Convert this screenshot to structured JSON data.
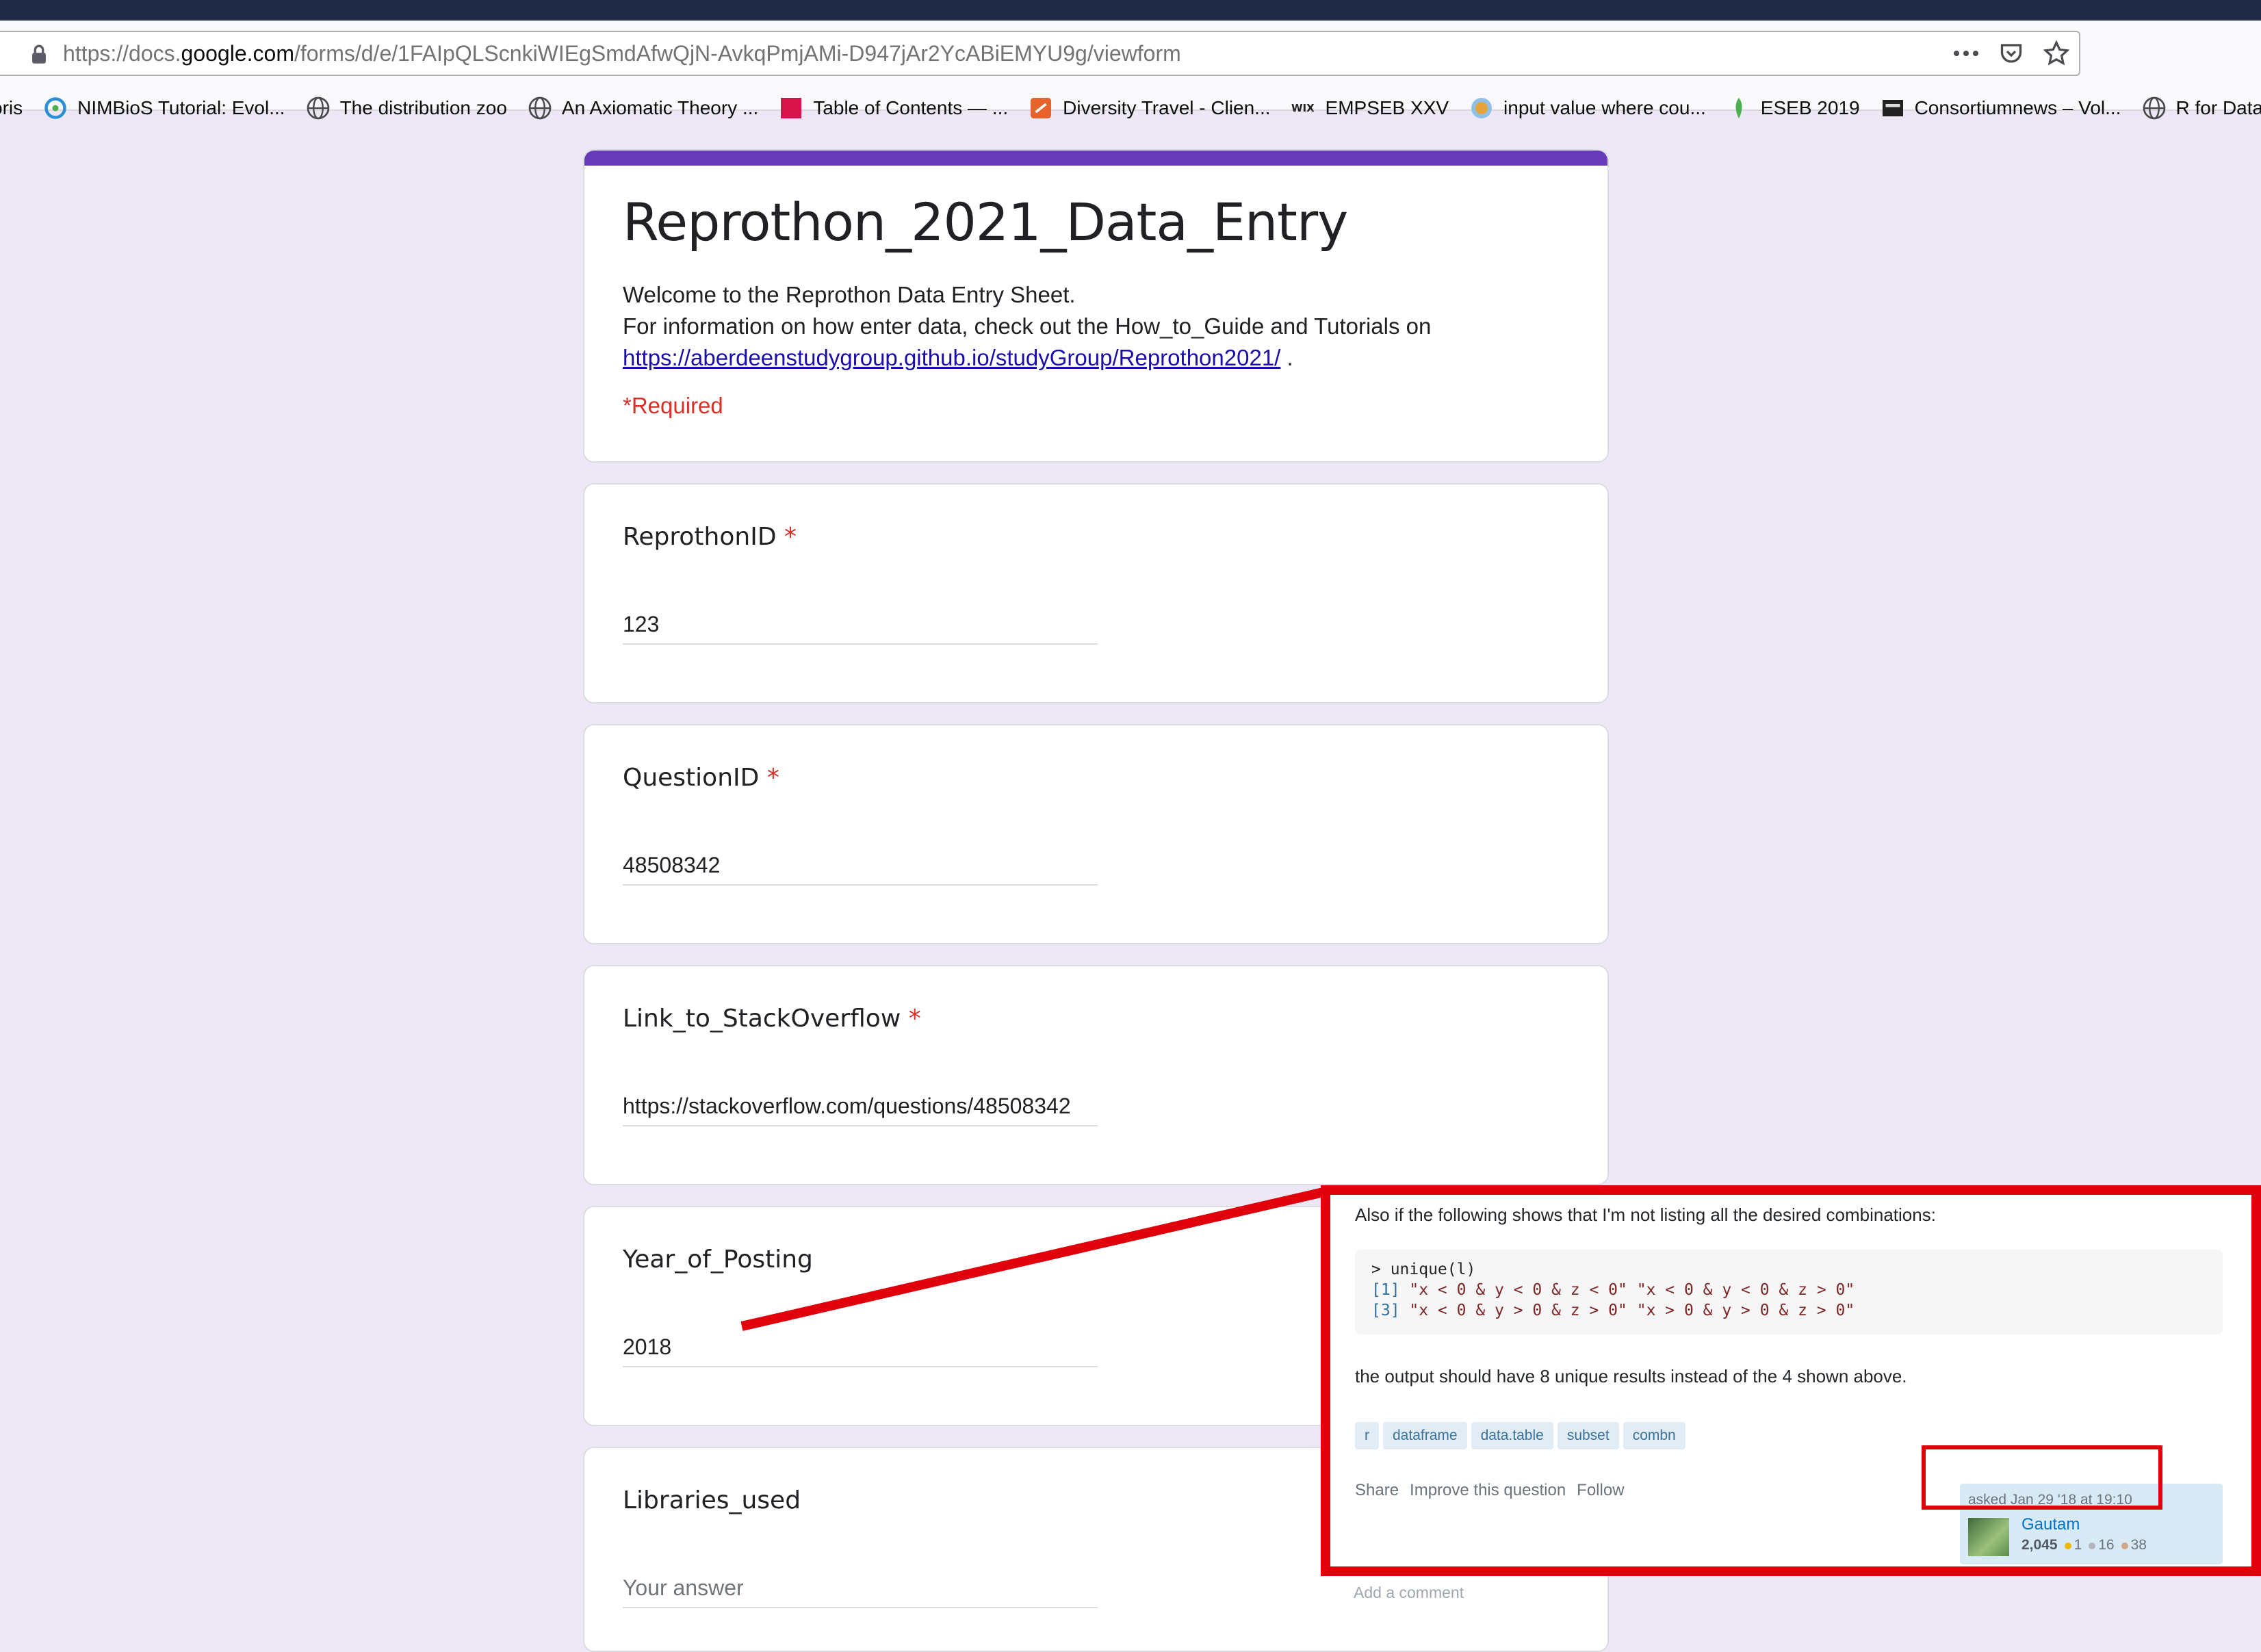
{
  "browser": {
    "url_prefix": "https://docs.",
    "url_domain": "google.com",
    "url_suffix": "/forms/d/e/1FAIpQLScnkiWIEgSmdAfwQjN-AvkqPmjAMi-D947jAr2YcABiEMYU9g/viewform",
    "bookmarks": [
      {
        "label": "oris",
        "icon": "none"
      },
      {
        "label": "NIMBioS Tutorial: Evol...",
        "icon": "nimbios-icon"
      },
      {
        "label": "The distribution zoo",
        "icon": "globe-icon"
      },
      {
        "label": "An Axiomatic Theory ...",
        "icon": "globe-icon"
      },
      {
        "label": "Table of Contents — ...",
        "icon": "red-square-icon"
      },
      {
        "label": "Diversity Travel - Clien...",
        "icon": "travel-icon"
      },
      {
        "label": "EMPSEB XXV",
        "icon": "wix-icon"
      },
      {
        "label": "input value where cou...",
        "icon": "r-globe-icon"
      },
      {
        "label": "ESEB 2019",
        "icon": "leaf-icon"
      },
      {
        "label": "Consortiumnews – Vol...",
        "icon": "news-icon"
      },
      {
        "label": "R for Data Scie",
        "icon": "globe-icon"
      }
    ]
  },
  "form": {
    "title": "Reprothon_2021_Data_Entry",
    "desc_line1": "Welcome to the Reprothon Data Entry Sheet.",
    "desc_line2": "For  information on how enter data, check out the How_to_Guide and Tutorials on",
    "desc_link": "https://aberdeenstudygroup.github.io/studyGroup/Reprothon2021/",
    "desc_after_link": " .",
    "required_note": "*Required",
    "accent_color": "#673ab7",
    "questions": [
      {
        "label": "ReprothonID",
        "required": "*",
        "value": "123"
      },
      {
        "label": "QuestionID",
        "required": "*",
        "value": "48508342"
      },
      {
        "label": "Link_to_StackOverflow",
        "required": "*",
        "value": "https://stackoverflow.com/questions/48508342"
      },
      {
        "label": "Year_of_Posting",
        "required": "",
        "value": "2018"
      },
      {
        "label": "Libraries_used",
        "required": "",
        "placeholder": "Your answer"
      }
    ]
  },
  "overlay": {
    "intro": "Also if the following shows that I'm not listing all the desired combinations:",
    "code_line1": "> unique(l)",
    "code_line2_idx": "[1]",
    "code_line2_str": " \"x < 0 & y < 0 & z < 0\" \"x < 0 & y < 0 & z > 0\"",
    "code_line3_idx": "[3]",
    "code_line3_str": " \"x < 0 & y > 0 & z > 0\" \"x > 0 & y > 0 & z > 0\"",
    "summary": "the output should have 8 unique results instead of the 4 shown above.",
    "tags": [
      "r",
      "dataframe",
      "data.table",
      "subset",
      "combn"
    ],
    "actions": [
      "Share",
      "Improve this question",
      "Follow"
    ],
    "asked": "asked Jan 29 '18 at 19:10",
    "user_name": "Gautam",
    "user_rep": "2,045",
    "gold": "1",
    "silver": "16",
    "bronze": "38",
    "add_comment": "Add a comment",
    "highlight_color": "#e0000b"
  }
}
